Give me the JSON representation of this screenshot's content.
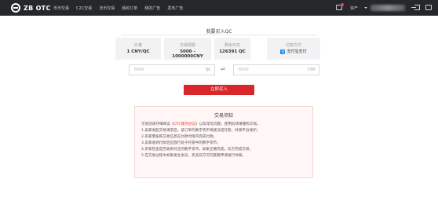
{
  "header": {
    "logo_text": "ZB OTC",
    "nav": [
      "币币交易",
      "C2C交易",
      "法币交易",
      "我的订单",
      "我的广告",
      "发布广告"
    ],
    "assets_label": "资产"
  },
  "page": {
    "title": "我要买入QC"
  },
  "info": {
    "price_label": "价格",
    "price_value": "1 CNY/QC",
    "limit_label": "交易限额",
    "limit_value": "5000 - 1000000CNY",
    "remain_label": "剩余可买",
    "remain_value": "126391 QC",
    "pay_label": "付款方式",
    "pay_value": "支付宝支付"
  },
  "form": {
    "amount_placeholder": "6000",
    "amount_unit": "QC",
    "cny_placeholder": "6000",
    "cny_unit": "CNY",
    "buy_button": "立即买入"
  },
  "notice": {
    "title": "交易须知",
    "intro_before": "交易前请仔细阅读《",
    "intro_link": "OTC服务协议",
    "intro_after": "》以及常见问题，使用前请慎重和交易。",
    "items": [
      "1.卖家发起交易请求后，该订单的数字货币将被冻结托管，并受平台保护。",
      "2.买家需按照交易信息在付款时限内完成付款。",
      "3.卖家收到付款后应放行处于托管中的数字货币。",
      "4.买家检查是否收到对应的数字货币，如果正确完成，双方完成交易。",
      "5.在交易过程中如果发生争议，买卖双方可向客服申请进行仲裁。"
    ]
  },
  "colors": {
    "header_bg": "#26272b",
    "accent_red": "#d9262b",
    "alipay_blue": "#1f8fe5"
  }
}
